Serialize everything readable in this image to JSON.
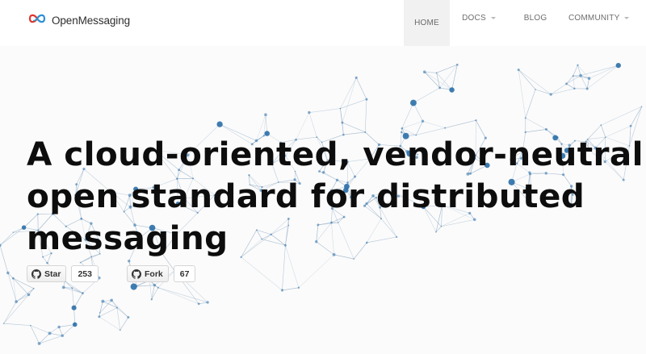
{
  "brand": {
    "name": "OpenMessaging",
    "logo_icon": "infinity-logo-icon"
  },
  "nav": {
    "items": [
      {
        "label": "HOME",
        "active": true,
        "dropdown": false
      },
      {
        "label": "DOCS",
        "active": false,
        "dropdown": true
      },
      {
        "label": "BLOG",
        "active": false,
        "dropdown": false
      },
      {
        "label": "COMMUNITY",
        "active": false,
        "dropdown": true
      }
    ]
  },
  "hero": {
    "headline_lines": [
      "A cloud-oriented, vendor-neutral",
      "open standard for distributed",
      "messaging"
    ],
    "background_icon": "network-graph-illustration"
  },
  "github": {
    "star": {
      "label": "Star",
      "count": "253",
      "icon": "github-icon"
    },
    "fork": {
      "label": "Fork",
      "count": "67",
      "icon": "github-icon"
    }
  },
  "colors": {
    "logo_blue": "#2c8fd6",
    "logo_red": "#e0342f",
    "network_node": "#2a6fa8",
    "network_line": "#9fb6cc",
    "headline": "#0d0d0d",
    "nav_text": "#6d6d6d"
  }
}
